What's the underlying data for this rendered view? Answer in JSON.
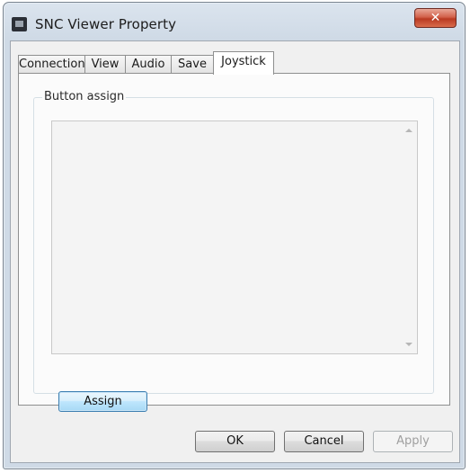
{
  "window": {
    "title": "SNC Viewer Property",
    "close_symbol": "✕"
  },
  "tabs": [
    {
      "label": "Connection",
      "active": false
    },
    {
      "label": "View",
      "active": false
    },
    {
      "label": "Audio",
      "active": false
    },
    {
      "label": "Save",
      "active": false
    },
    {
      "label": "Joystick",
      "active": true
    }
  ],
  "joystick": {
    "group_label": "Button assign",
    "button_list": [],
    "assign_label": "Assign"
  },
  "footer": {
    "ok_label": "OK",
    "cancel_label": "Cancel",
    "apply_label": "Apply"
  },
  "icons": {
    "app": "camera-app-icon",
    "close": "close-icon",
    "scroll_up": "scroll-up-arrow-icon",
    "scroll_down": "scroll-down-arrow-icon"
  },
  "colors": {
    "close_button": "#c4432a",
    "focus_button_border": "#3c7fb1",
    "disabled_text": "#a0a0a0"
  }
}
